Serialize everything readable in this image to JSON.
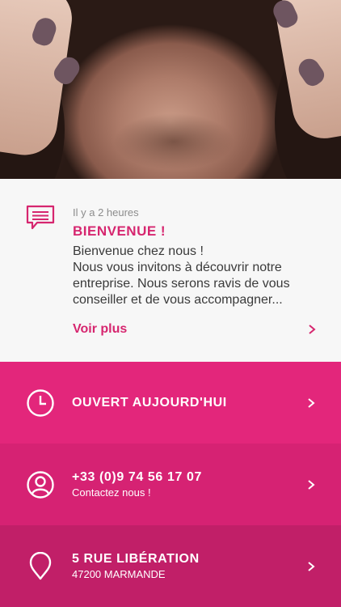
{
  "hero": {
    "image": "portrait-photo-neck-hands-hair"
  },
  "message": {
    "icon": "message-icon",
    "time": "Il y a 2 heures",
    "title": "BIENVENUE !",
    "body_lines": [
      "Bienvenue chez nous !",
      "Nous vous invitons à découvrir notre",
      "entreprise. Nous serons ravis de vous",
      "conseiller et de vous accompagner..."
    ],
    "more_label": "Voir plus"
  },
  "hours": {
    "icon": "clock-icon",
    "title": "OUVERT AUJOURD'HUI"
  },
  "phone": {
    "icon": "user-circle-icon",
    "title": "+33 (0)9 74 56 17 07",
    "subtitle": "Contactez nous !"
  },
  "address": {
    "icon": "location-pin-icon",
    "title": "5 RUE LIBÉRATION",
    "subtitle": "47200 MARMANDE"
  },
  "colors": {
    "accent": "#d6266f",
    "row_hours": "#e3267b",
    "row_phone": "#d62273",
    "row_address": "#c11f68",
    "card_bg": "#f7f7f7"
  }
}
